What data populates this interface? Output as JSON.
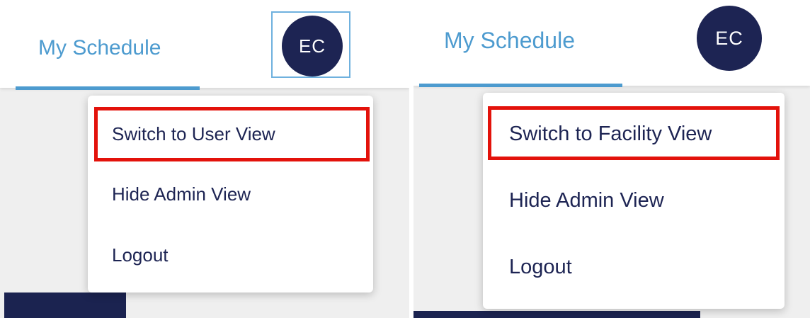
{
  "left_panel": {
    "tab_label": "My Schedule",
    "avatar_initials": "EC",
    "menu": [
      {
        "label": "Switch to User View",
        "highlighted": true
      },
      {
        "label": "Hide Admin View",
        "highlighted": false
      },
      {
        "label": "Logout",
        "highlighted": false
      }
    ]
  },
  "right_panel": {
    "tab_label": "My Schedule",
    "avatar_initials": "EC",
    "menu": [
      {
        "label": "Switch to Facility View",
        "highlighted": true
      },
      {
        "label": "Hide Admin View",
        "highlighted": false
      },
      {
        "label": "Logout",
        "highlighted": false
      }
    ]
  },
  "colors": {
    "accent_blue": "#4d9bcf",
    "navy": "#1d2453",
    "highlight_red": "#e3120b",
    "focus_outline": "#6fb1de"
  }
}
